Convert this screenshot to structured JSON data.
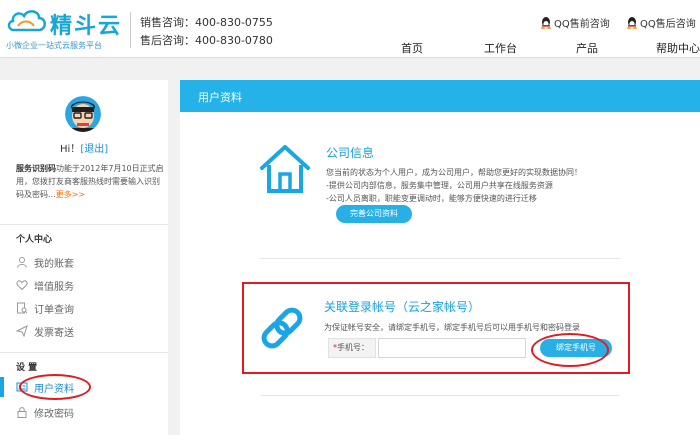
{
  "brand": {
    "name": "精斗云",
    "slogan": "小微企业一站式云服务平台",
    "color": "#16a7d6"
  },
  "contact": {
    "sales": "销售咨询：400-830-0755",
    "after_sales": "售后咨询：400-830-0780"
  },
  "qq": {
    "pre_sales": "QQ售前咨询",
    "after_sales": "QQ售后咨询"
  },
  "nav": {
    "items": [
      "首页",
      "工作台",
      "产品",
      "帮助中心"
    ]
  },
  "sidebar": {
    "greeting": "Hi！",
    "logout": "[退出]",
    "service_code_title": "服务识别码",
    "service_code_text": "功能于2012年7月10日正式启用，您拨打友商客服热线时需要输入识别码及密码...",
    "more": "更多>>",
    "section_personal": "个人中心",
    "personal_items": [
      "我的账套",
      "增值服务",
      "订单查询",
      "发票寄送"
    ],
    "section_settings": "设 置",
    "settings_items": [
      "用户资料",
      "修改密码"
    ]
  },
  "main": {
    "title": "用户资料",
    "company": {
      "title": "公司信息",
      "line1": "您当前的状态为个人用户，成为公司用户，帮助您更好的实现数据协同！",
      "line2": "-提供公司内部信息，服务集中管理，公司用户共享在线服务资源",
      "line3": "-公司人员离职，职能变更调动时，能够方便快速的进行迁移",
      "button": "完善公司资料"
    },
    "link": {
      "title": "关联登录帐号（云之家帐号）",
      "desc": "为保证帐号安全，请绑定手机号，绑定手机号后可以用手机号和密码登录",
      "phone_required": "*",
      "phone_label": "手机号：",
      "phone_value": "",
      "button": "绑定手机号"
    }
  },
  "colors": {
    "accent": "#25b2e8",
    "highlight": "#e01b22",
    "link": "#1a8fd4"
  }
}
